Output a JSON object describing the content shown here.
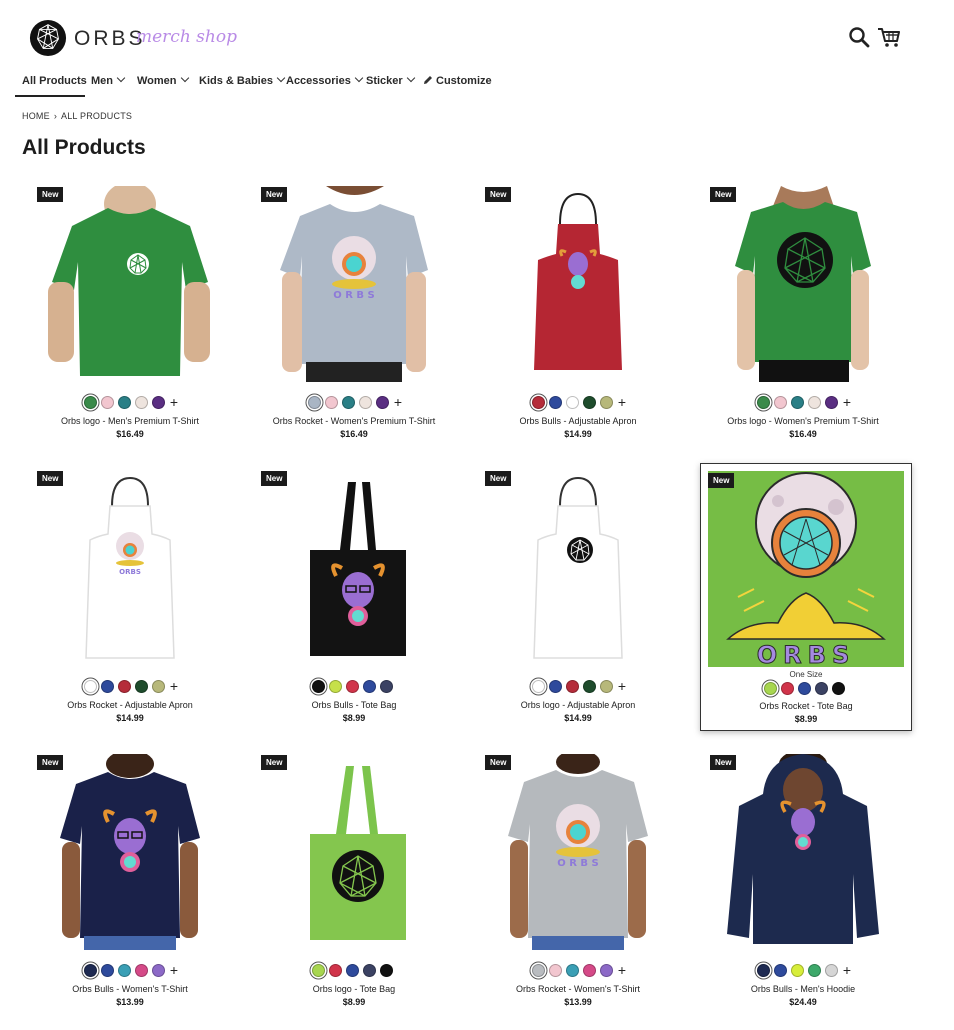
{
  "brand": {
    "name": "ORBS",
    "tagline": "merch shop"
  },
  "header": {
    "search_icon": "search-icon",
    "cart_icon": "cart-icon"
  },
  "nav": [
    {
      "label": "All Products",
      "active": true
    },
    {
      "label": "Men",
      "dropdown": true
    },
    {
      "label": "Women",
      "dropdown": true
    },
    {
      "label": "Kids & Babies",
      "dropdown": true
    },
    {
      "label": "Accessories",
      "dropdown": true
    },
    {
      "label": "Sticker",
      "dropdown": true
    },
    {
      "label": "Customize",
      "icon": "pencil-icon"
    }
  ],
  "breadcrumb": {
    "home": "HOME",
    "current": "ALL PRODUCTS"
  },
  "page_title": "All Products",
  "products": [
    {
      "badge": "New",
      "name": "Orbs logo - Men's Premium T-Shirt",
      "price": "$16.49",
      "swatches": [
        "#3a8a4a",
        "#f2c6cf",
        "#2a7f86",
        "#eee4de",
        "#5a2e82"
      ],
      "more": "+"
    },
    {
      "badge": "New",
      "name": "Orbs Rocket - Women's Premium T-Shirt",
      "price": "$16.49",
      "swatches": [
        "#a9b5c4",
        "#f2c6cf",
        "#2a7f86",
        "#eee4de",
        "#5a2e82"
      ],
      "more": "+"
    },
    {
      "badge": "New",
      "name": "Orbs Bulls - Adjustable Apron",
      "price": "$14.99",
      "swatches": [
        "#b52c3a",
        "#2e4a9c",
        "#ffffff",
        "#1e4c2c",
        "#b7b87a"
      ],
      "more": "+"
    },
    {
      "badge": "New",
      "name": "Orbs logo - Women's Premium T-Shirt",
      "price": "$16.49",
      "swatches": [
        "#3a8a4a",
        "#f2c6cf",
        "#2a7f86",
        "#eee4de",
        "#5a2e82"
      ],
      "more": "+"
    },
    {
      "badge": "New",
      "name": "Orbs Rocket - Adjustable Apron",
      "price": "$14.99",
      "swatches": [
        "#ffffff",
        "#2e4a9c",
        "#b52c3a",
        "#1e4c2c",
        "#b7b87a"
      ],
      "more": "+"
    },
    {
      "badge": "New",
      "name": "Orbs Bulls - Tote Bag",
      "price": "$8.99",
      "swatches": [
        "#111111",
        "#c6e04a",
        "#d1344a",
        "#2e4a9c",
        "#3b4263"
      ],
      "more": ""
    },
    {
      "badge": "New",
      "name": "Orbs logo - Adjustable Apron",
      "price": "$14.99",
      "swatches": [
        "#ffffff",
        "#2e4a9c",
        "#b52c3a",
        "#1e4c2c",
        "#b7b87a"
      ],
      "more": "+"
    },
    {
      "badge": "New",
      "name": "Orbs Rocket - Tote Bag",
      "price": "$8.99",
      "size": "One Size",
      "swatches": [
        "#a7d64f",
        "#d1344a",
        "#2e4a9c",
        "#3b4263",
        "#111111"
      ],
      "more": ""
    },
    {
      "badge": "New",
      "name": "Orbs Bulls - Women's T-Shirt",
      "price": "$13.99",
      "swatches": [
        "#1e2a52",
        "#2e4a9c",
        "#3a9fb5",
        "#d54a88",
        "#8c69c7"
      ],
      "more": "+"
    },
    {
      "badge": "New",
      "name": "Orbs logo - Tote Bag",
      "price": "$8.99",
      "swatches": [
        "#a7d64f",
        "#d1344a",
        "#2e4a9c",
        "#3b4263",
        "#111111"
      ],
      "more": ""
    },
    {
      "badge": "New",
      "name": "Orbs Rocket - Women's T-Shirt",
      "price": "$13.99",
      "swatches": [
        "#b9bcc0",
        "#f2c6cf",
        "#3a9fb5",
        "#d54a88",
        "#8c69c7"
      ],
      "more": "+"
    },
    {
      "badge": "New",
      "name": "Orbs Bulls - Men's Hoodie",
      "price": "$24.49",
      "swatches": [
        "#1e2a52",
        "#2e4a9c",
        "#d7ee3a",
        "#3da86a",
        "#d6d6d6"
      ],
      "more": "+"
    }
  ]
}
